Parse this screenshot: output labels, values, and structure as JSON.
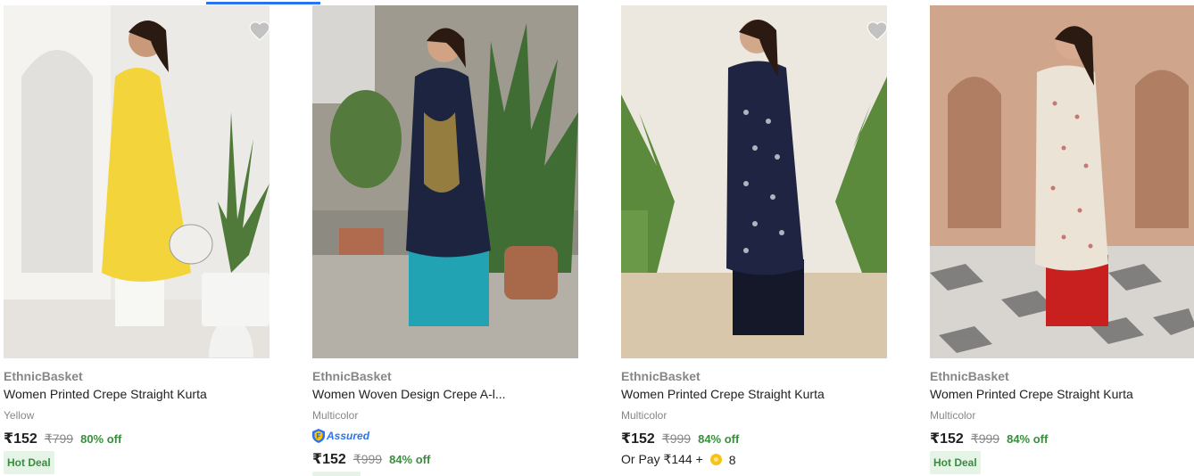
{
  "products": [
    {
      "brand": "EthnicBasket",
      "title": "Women Printed Crepe Straight Kurta",
      "color": "Yellow",
      "price": "₹152",
      "mrp": "₹799",
      "discount": "80% off",
      "badge": "Hot Deal",
      "kurta_color": "#f3d43a",
      "bottom_color": "#f7f7f4"
    },
    {
      "brand": "EthnicBasket",
      "title": "Women Woven Design Crepe A-l...",
      "color": "Multicolor",
      "assured_label": "Assured",
      "price": "₹152",
      "mrp": "₹999",
      "discount": "84% off",
      "kurta_color": "#1d2440",
      "bottom_color": "#22a3b4"
    },
    {
      "brand": "EthnicBasket",
      "title": "Women Printed Crepe Straight Kurta",
      "color": "Multicolor",
      "price": "₹152",
      "mrp": "₹999",
      "discount": "84% off",
      "pay_points": {
        "text": "Or Pay ₹144 +",
        "points": "8"
      },
      "kurta_color": "#1e2442",
      "bottom_color": "#141828"
    },
    {
      "brand": "EthnicBasket",
      "title": "Women Printed Crepe Straight Kurta",
      "color": "Multicolor",
      "price": "₹152",
      "mrp": "₹999",
      "discount": "84% off",
      "badge": "Hot Deal",
      "kurta_color": "#ebe3d6",
      "bottom_color": "#c8201e"
    }
  ],
  "colors": {
    "accent": "#2874f0",
    "discount_green": "#388e3c",
    "hot_deal_bg": "#e6f4e7",
    "muted_text": "#878787",
    "wishlist_heart": "#c2c2c2"
  }
}
